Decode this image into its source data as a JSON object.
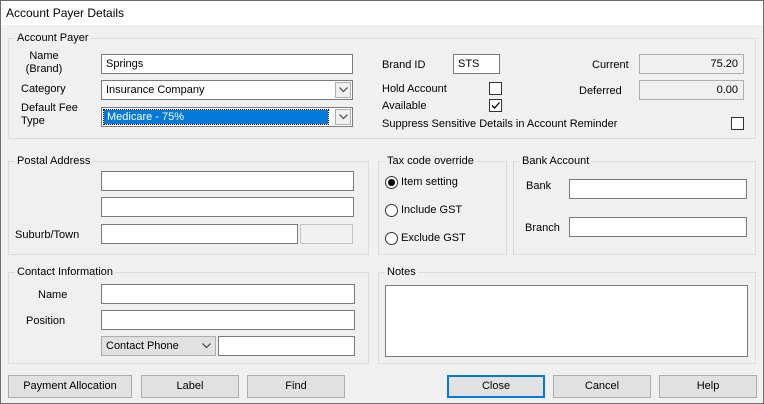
{
  "window": {
    "title": "Account Payer Details"
  },
  "account_payer": {
    "group_title": "Account Payer",
    "name_label": "Name\n(Brand)",
    "name_value": "Springs",
    "category_label": "Category",
    "category_value": "Insurance Company",
    "fee_type_label": "Default Fee\nType",
    "fee_type_value": "Medicare - 75%",
    "brand_id_label": "Brand ID",
    "brand_id_value": "STS",
    "hold_account_label": "Hold Account",
    "hold_account_checked": false,
    "available_label": "Available",
    "available_checked": true,
    "current_label": "Current",
    "current_value": "75.20",
    "deferred_label": "Deferred",
    "deferred_value": "0.00",
    "suppress_label": "Suppress Sensitive Details in Account Reminder",
    "suppress_checked": false
  },
  "postal_address": {
    "group_title": "Postal Address",
    "line1": "",
    "line2": "",
    "suburb_label": "Suburb/Town",
    "suburb_value": "",
    "postcode_value": ""
  },
  "tax_code": {
    "group_title": "Tax code override",
    "options": [
      "Item setting",
      "Include GST",
      "Exclude GST"
    ],
    "selected": "Item setting"
  },
  "bank_account": {
    "group_title": "Bank Account",
    "bank_label": "Bank",
    "bank_value": "",
    "branch_label": "Branch",
    "branch_value": ""
  },
  "contact": {
    "group_title": "Contact Information",
    "name_label": "Name",
    "name_value": "",
    "position_label": "Position",
    "position_value": "",
    "phone_type_value": "Contact Phone",
    "phone_value": ""
  },
  "notes": {
    "group_title": "Notes",
    "value": ""
  },
  "buttons": {
    "payment_allocation": "Payment Allocation",
    "label": "Label",
    "find": "Find",
    "close": "Close",
    "cancel": "Cancel",
    "help": "Help"
  }
}
